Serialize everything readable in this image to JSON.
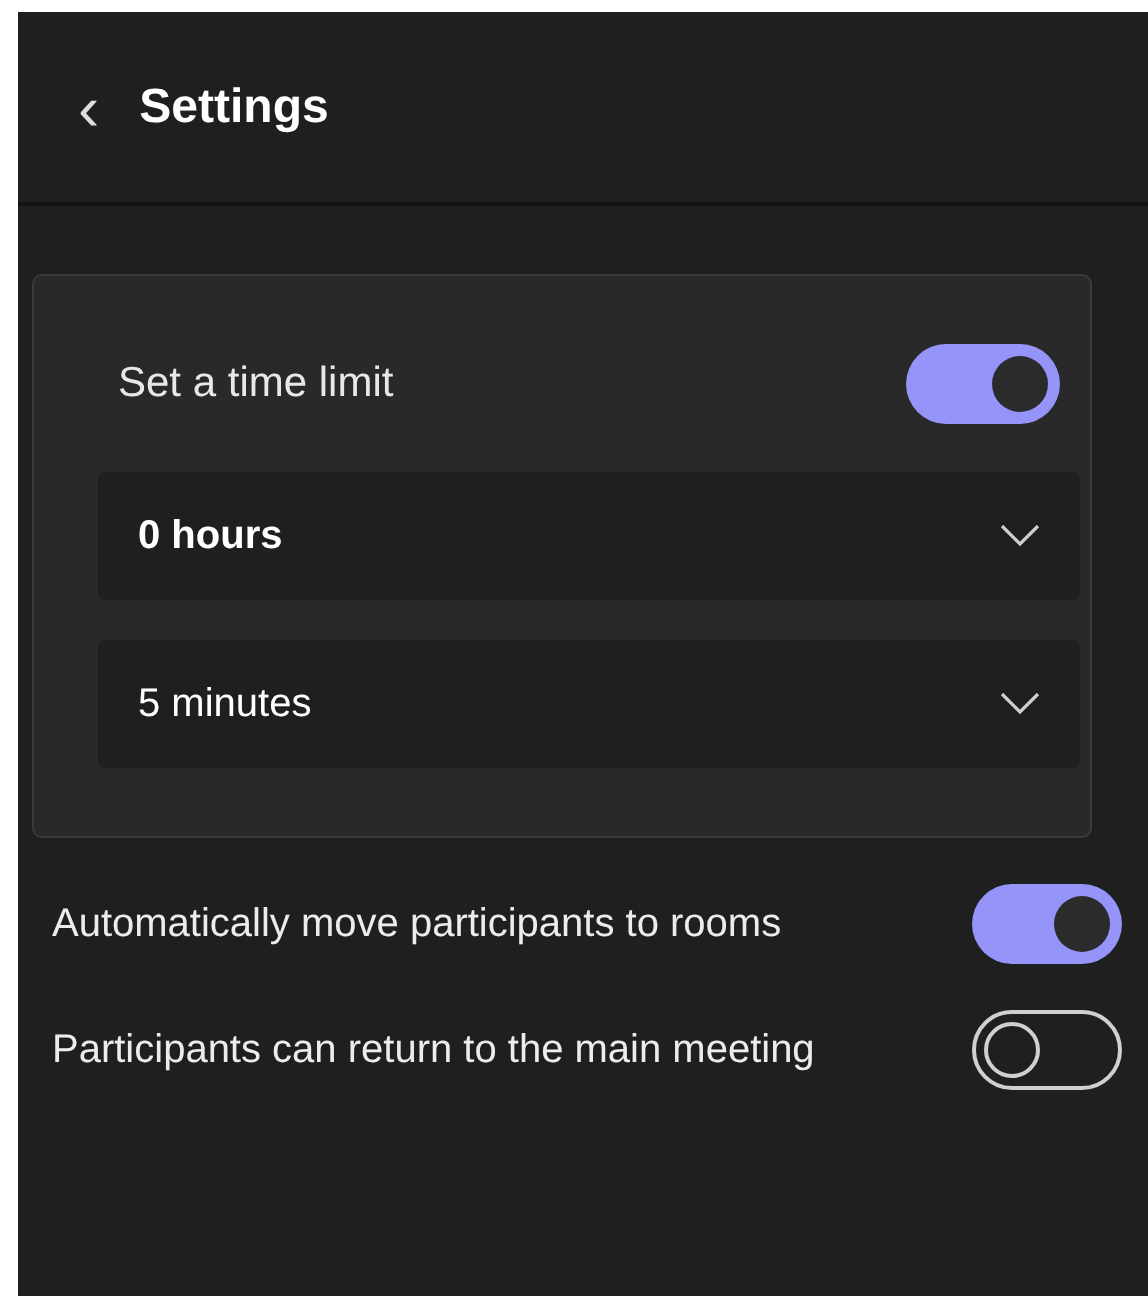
{
  "header": {
    "back_icon": "‹",
    "title": "Settings"
  },
  "time_limit": {
    "label": "Set a time limit",
    "on": true,
    "dropdowns": [
      {
        "value": "0 hours",
        "bold": true
      },
      {
        "value": "5 minutes",
        "bold": false
      }
    ]
  },
  "options": [
    {
      "label": "Automatically move participants to rooms",
      "on": true
    },
    {
      "label": "Participants can return to the main meeting",
      "on": false
    }
  ]
}
